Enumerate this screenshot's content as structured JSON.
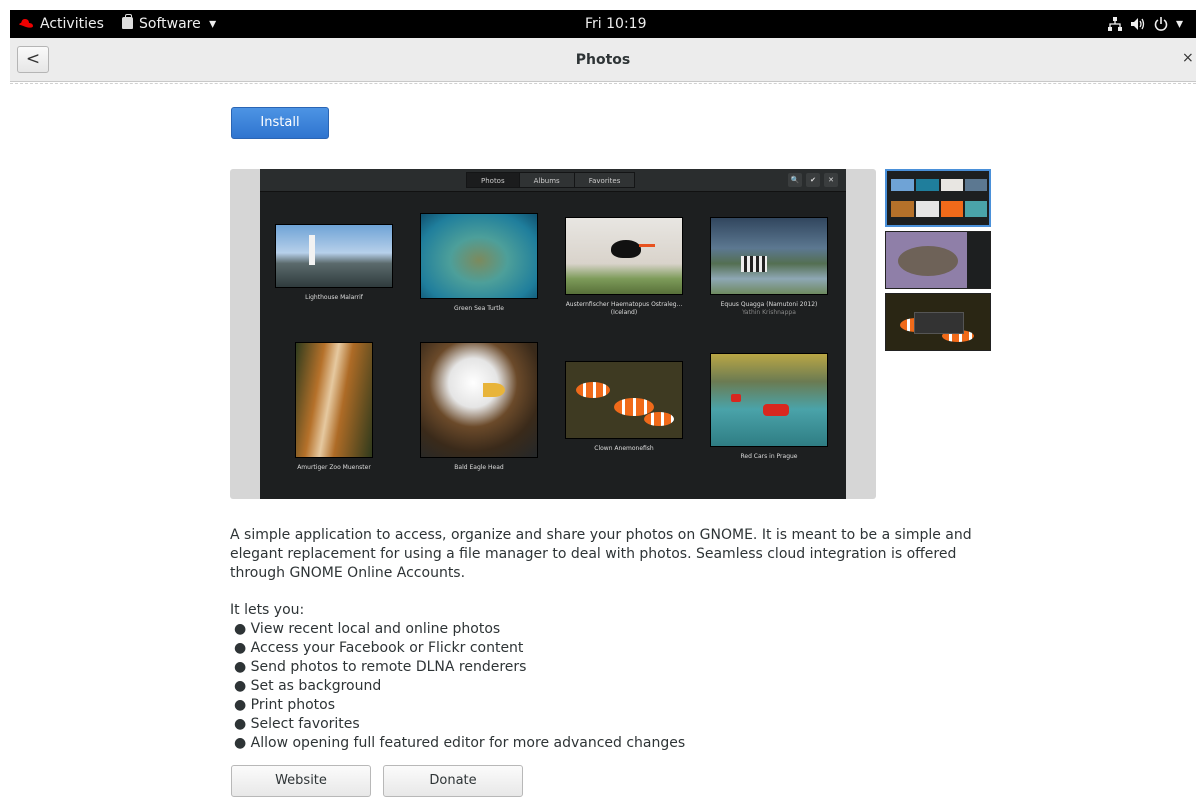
{
  "topbar": {
    "activities": "Activities",
    "app_menu": "Software",
    "app_menu_arrow": "▾",
    "clock": "Fri 10:19",
    "status_icons": [
      "network-icon",
      "volume-icon",
      "power-icon"
    ],
    "status_arrow": "▾"
  },
  "header": {
    "back_glyph": "<",
    "title": "Photos",
    "close_glyph": "×"
  },
  "actions": {
    "install_label": "Install"
  },
  "screenshot": {
    "tabs": [
      "Photos",
      "Albums",
      "Favorites"
    ],
    "tools": [
      "🔍",
      "✔",
      "✕"
    ],
    "photos": [
      {
        "caption": "Lighthouse Malarrif"
      },
      {
        "caption": "Green Sea Turtle"
      },
      {
        "caption": "Austernfischer Haematopus Ostraleg...(Iceland)"
      },
      {
        "caption": "Equus Quagga (Namutoni 2012)",
        "sub": "Yathin Krishnappa"
      },
      {
        "caption": "Amurtiger Zoo Muenster"
      },
      {
        "caption": "Bald Eagle Head"
      },
      {
        "caption": "Clown Anemonefish"
      },
      {
        "caption": "Red Cars in Prague"
      }
    ]
  },
  "description": {
    "paragraph": "A simple application to access, organize and share your photos on GNOME. It is meant to be a simple and elegant replacement for using a file manager to deal with photos. Seamless cloud integration is offered through GNOME Online Accounts.",
    "intro": "It lets you:",
    "features": [
      "● View recent local and online photos",
      "● Access your Facebook or Flickr content",
      "● Send photos to remote DLNA renderers",
      "● Set as background",
      "● Print photos",
      "● Select favorites",
      "● Allow opening full featured editor for more advanced changes"
    ]
  },
  "links": {
    "website_label": "Website",
    "donate_label": "Donate"
  },
  "colors": {
    "accent": "#3584e4",
    "topbar": "#000000",
    "headerbar": "#ececec",
    "screenshot_bg": "#1d1f20"
  }
}
